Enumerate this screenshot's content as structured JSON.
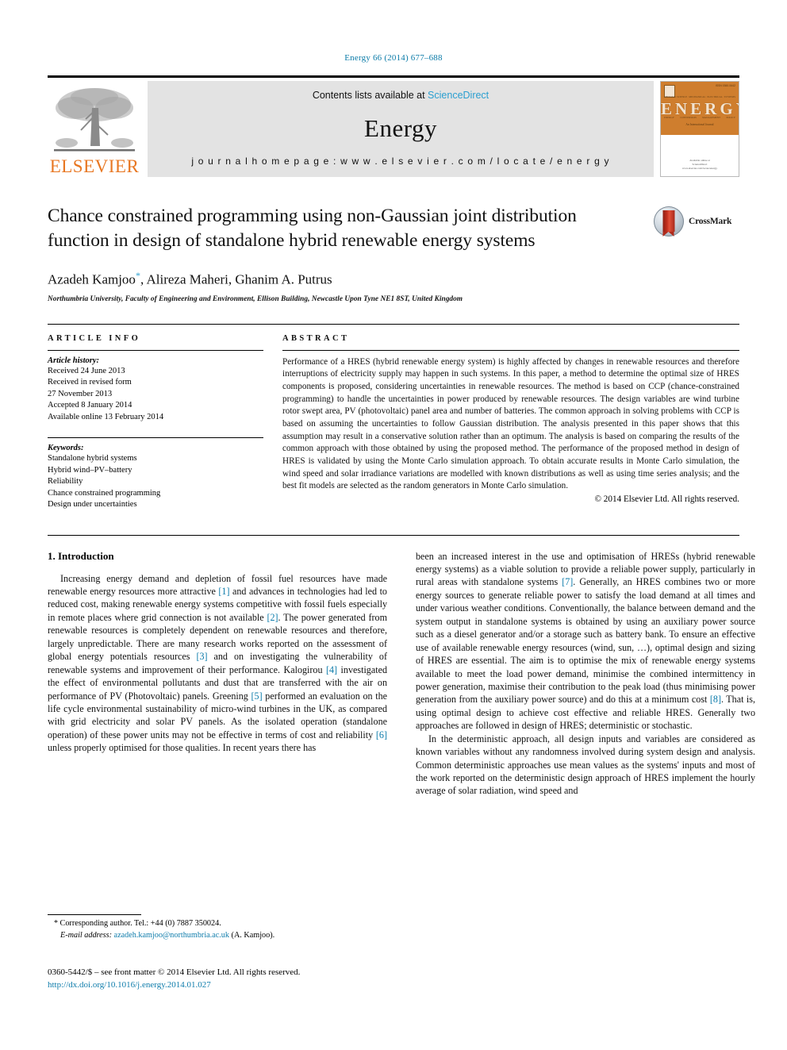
{
  "running_head": "Energy 66 (2014) 677–688",
  "masthead": {
    "contents_prefix": "Contents lists available at ",
    "sciencedirect": "ScienceDirect",
    "journal_name": "Energy",
    "homepage": "j o u r n a l   h o m e p a g e :   w w w . e l s e v i e r . c o m / l o c a t e / e n e r g y",
    "publisher_logo_text": "ELSEVIER",
    "cover": {
      "title": "ENERGY",
      "issn": "ISSN 0360-5442",
      "tagline": "An International Journal",
      "top_labels": [
        "THERMAL SCIENCE",
        "MECHANICAL",
        "ELECTRICAL",
        "SYSTEMS"
      ],
      "bottom_labels": [
        "ENERGY",
        "CONVERSION",
        "MANAGEMENT",
        "POLICY"
      ],
      "footer_line1": "Available online at",
      "footer_line2": "ScienceDirect",
      "footer_line3": "www.elsevier.com/locate/energy"
    }
  },
  "article": {
    "title": "Chance constrained programming using non-Gaussian joint distribution function in design of standalone hybrid renewable energy systems",
    "crossmark_label": "CrossMark",
    "authors": "Azadeh Kamjoo, Alireza Maheri, Ghanim A. Putrus",
    "author_marker": "*",
    "authors_before_marker": "Azadeh Kamjoo",
    "authors_after_marker": ", Alireza Maheri, Ghanim A. Putrus",
    "affiliation": "Northumbria University, Faculty of Engineering and Environment, Ellison Building, Newcastle Upon Tyne NE1 8ST, United Kingdom"
  },
  "article_info": {
    "heading": "ARTICLE INFO",
    "history_label": "Article history:",
    "history": [
      "Received 24 June 2013",
      "Received in revised form",
      "27 November 2013",
      "Accepted 8 January 2014",
      "Available online 13 February 2014"
    ],
    "keywords_label": "Keywords:",
    "keywords": [
      "Standalone hybrid systems",
      "Hybrid wind–PV–battery",
      "Reliability",
      "Chance constrained programming",
      "Design under uncertainties"
    ]
  },
  "abstract": {
    "heading": "ABSTRACT",
    "text": "Performance of a HRES (hybrid renewable energy system) is highly affected by changes in renewable resources and therefore interruptions of electricity supply may happen in such systems. In this paper, a method to determine the optimal size of HRES components is proposed, considering uncertainties in renewable resources. The method is based on CCP (chance-constrained programming) to handle the uncertainties in power produced by renewable resources. The design variables are wind turbine rotor swept area, PV (photovoltaic) panel area and number of batteries. The common approach in solving problems with CCP is based on assuming the uncertainties to follow Gaussian distribution. The analysis presented in this paper shows that this assumption may result in a conservative solution rather than an optimum. The analysis is based on comparing the results of the common approach with those obtained by using the proposed method. The performance of the proposed method in design of HRES is validated by using the Monte Carlo simulation approach. To obtain accurate results in Monte Carlo simulation, the wind speed and solar irradiance variations are modelled with known distributions as well as using time series analysis; and the best fit models are selected as the random generators in Monte Carlo simulation.",
    "copyright": "© 2014 Elsevier Ltd. All rights reserved."
  },
  "body": {
    "section_heading": "1. Introduction",
    "left_paragraph_1_parts": [
      "Increasing energy demand and depletion of fossil fuel resources have made renewable energy resources more attractive ",
      "[1]",
      " and advances in technologies had led to reduced cost, making renewable energy systems competitive with fossil fuels especially in remote places where grid connection is not available ",
      "[2]",
      ". The power generated from renewable resources is completely dependent on renewable resources and therefore, largely unpredictable. There are many research works reported on the assessment of global energy potentials resources ",
      "[3]",
      " and on investigating the vulnerability of renewable systems and improvement of their performance. Kalogirou ",
      "[4]",
      " investigated the effect of environmental pollutants and dust that are transferred with the air on performance of PV (Photovoltaic) panels. Greening ",
      "[5]",
      " performed an evaluation on the life cycle environmental sustainability of micro-wind turbines in the UK, as compared with grid electricity and solar PV panels. As the isolated operation (standalone operation) of these power units may not be effective in terms of cost and reliability ",
      "[6]",
      " unless properly optimised for those qualities. In recent years there has"
    ],
    "right_paragraph_1_parts": [
      "been an increased interest in the use and optimisation of HRESs (hybrid renewable energy systems) as a viable solution to provide a reliable power supply, particularly in rural areas with standalone systems ",
      "[7]",
      ". Generally, an HRES combines two or more energy sources to generate reliable power to satisfy the load demand at all times and under various weather conditions. Conventionally, the balance between demand and the system output in standalone systems is obtained by using an auxiliary power source such as a diesel generator and/or a storage such as battery bank. To ensure an effective use of available renewable energy resources (wind, sun, …), optimal design and sizing of HRES are essential. The aim is to optimise the mix of renewable energy systems available to meet the load power demand, minimise the combined intermittency in power generation, maximise their contribution to the peak load (thus minimising power generation from the auxiliary power source) and do this at a minimum cost ",
      "[8]",
      ". That is, using optimal design to achieve cost effective and reliable HRES. Generally two approaches are followed in design of HRES; deterministic or stochastic."
    ],
    "right_paragraph_2": "In the deterministic approach, all design inputs and variables are considered as known variables without any randomness involved during system design and analysis. Common deterministic approaches use mean values as the systems' inputs and most of the work reported on the deterministic design approach of HRES implement the hourly average of solar radiation, wind speed and"
  },
  "footnotes": {
    "corresponding_marker": "*",
    "corresponding": "Corresponding author. Tel.: +44 (0) 7887 350024.",
    "email_label": "E-mail address:",
    "email": "azadeh.kamjoo@northumbria.ac.uk",
    "email_suffix": "(A. Kamjoo).",
    "issn_line": "0360-5442/$ – see front matter © 2014 Elsevier Ltd. All rights reserved.",
    "doi": "http://dx.doi.org/10.1016/j.energy.2014.01.027"
  },
  "colors": {
    "link": "#0e7cab",
    "sciencedirect": "#2a9fd0",
    "elsevier_orange": "#E87722",
    "cover_orange": "#cf7e2e"
  }
}
